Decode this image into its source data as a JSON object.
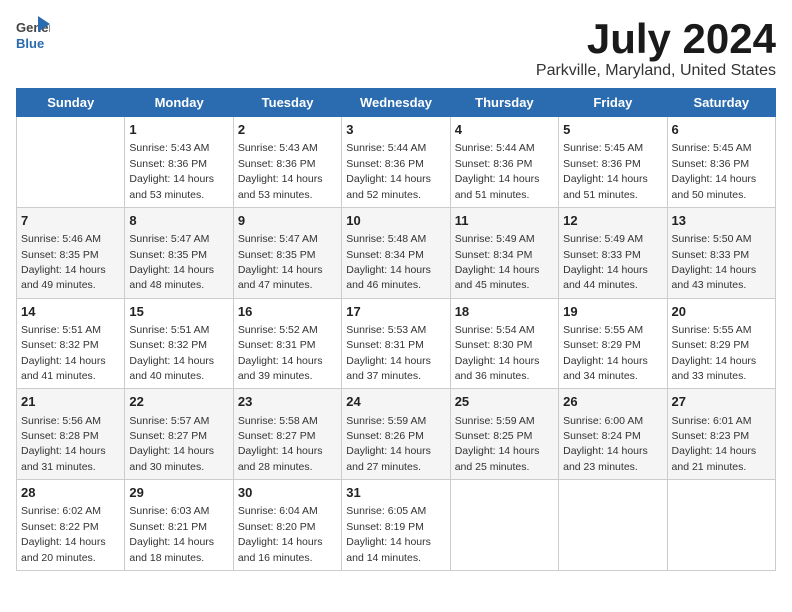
{
  "logo": {
    "text_general": "General",
    "text_blue": "Blue"
  },
  "title": "July 2024",
  "subtitle": "Parkville, Maryland, United States",
  "weekdays": [
    "Sunday",
    "Monday",
    "Tuesday",
    "Wednesday",
    "Thursday",
    "Friday",
    "Saturday"
  ],
  "weeks": [
    [
      {
        "day": "",
        "sunrise": "",
        "sunset": "",
        "daylight": ""
      },
      {
        "day": "1",
        "sunrise": "Sunrise: 5:43 AM",
        "sunset": "Sunset: 8:36 PM",
        "daylight": "Daylight: 14 hours and 53 minutes."
      },
      {
        "day": "2",
        "sunrise": "Sunrise: 5:43 AM",
        "sunset": "Sunset: 8:36 PM",
        "daylight": "Daylight: 14 hours and 53 minutes."
      },
      {
        "day": "3",
        "sunrise": "Sunrise: 5:44 AM",
        "sunset": "Sunset: 8:36 PM",
        "daylight": "Daylight: 14 hours and 52 minutes."
      },
      {
        "day": "4",
        "sunrise": "Sunrise: 5:44 AM",
        "sunset": "Sunset: 8:36 PM",
        "daylight": "Daylight: 14 hours and 51 minutes."
      },
      {
        "day": "5",
        "sunrise": "Sunrise: 5:45 AM",
        "sunset": "Sunset: 8:36 PM",
        "daylight": "Daylight: 14 hours and 51 minutes."
      },
      {
        "day": "6",
        "sunrise": "Sunrise: 5:45 AM",
        "sunset": "Sunset: 8:36 PM",
        "daylight": "Daylight: 14 hours and 50 minutes."
      }
    ],
    [
      {
        "day": "7",
        "sunrise": "Sunrise: 5:46 AM",
        "sunset": "Sunset: 8:35 PM",
        "daylight": "Daylight: 14 hours and 49 minutes."
      },
      {
        "day": "8",
        "sunrise": "Sunrise: 5:47 AM",
        "sunset": "Sunset: 8:35 PM",
        "daylight": "Daylight: 14 hours and 48 minutes."
      },
      {
        "day": "9",
        "sunrise": "Sunrise: 5:47 AM",
        "sunset": "Sunset: 8:35 PM",
        "daylight": "Daylight: 14 hours and 47 minutes."
      },
      {
        "day": "10",
        "sunrise": "Sunrise: 5:48 AM",
        "sunset": "Sunset: 8:34 PM",
        "daylight": "Daylight: 14 hours and 46 minutes."
      },
      {
        "day": "11",
        "sunrise": "Sunrise: 5:49 AM",
        "sunset": "Sunset: 8:34 PM",
        "daylight": "Daylight: 14 hours and 45 minutes."
      },
      {
        "day": "12",
        "sunrise": "Sunrise: 5:49 AM",
        "sunset": "Sunset: 8:33 PM",
        "daylight": "Daylight: 14 hours and 44 minutes."
      },
      {
        "day": "13",
        "sunrise": "Sunrise: 5:50 AM",
        "sunset": "Sunset: 8:33 PM",
        "daylight": "Daylight: 14 hours and 43 minutes."
      }
    ],
    [
      {
        "day": "14",
        "sunrise": "Sunrise: 5:51 AM",
        "sunset": "Sunset: 8:32 PM",
        "daylight": "Daylight: 14 hours and 41 minutes."
      },
      {
        "day": "15",
        "sunrise": "Sunrise: 5:51 AM",
        "sunset": "Sunset: 8:32 PM",
        "daylight": "Daylight: 14 hours and 40 minutes."
      },
      {
        "day": "16",
        "sunrise": "Sunrise: 5:52 AM",
        "sunset": "Sunset: 8:31 PM",
        "daylight": "Daylight: 14 hours and 39 minutes."
      },
      {
        "day": "17",
        "sunrise": "Sunrise: 5:53 AM",
        "sunset": "Sunset: 8:31 PM",
        "daylight": "Daylight: 14 hours and 37 minutes."
      },
      {
        "day": "18",
        "sunrise": "Sunrise: 5:54 AM",
        "sunset": "Sunset: 8:30 PM",
        "daylight": "Daylight: 14 hours and 36 minutes."
      },
      {
        "day": "19",
        "sunrise": "Sunrise: 5:55 AM",
        "sunset": "Sunset: 8:29 PM",
        "daylight": "Daylight: 14 hours and 34 minutes."
      },
      {
        "day": "20",
        "sunrise": "Sunrise: 5:55 AM",
        "sunset": "Sunset: 8:29 PM",
        "daylight": "Daylight: 14 hours and 33 minutes."
      }
    ],
    [
      {
        "day": "21",
        "sunrise": "Sunrise: 5:56 AM",
        "sunset": "Sunset: 8:28 PM",
        "daylight": "Daylight: 14 hours and 31 minutes."
      },
      {
        "day": "22",
        "sunrise": "Sunrise: 5:57 AM",
        "sunset": "Sunset: 8:27 PM",
        "daylight": "Daylight: 14 hours and 30 minutes."
      },
      {
        "day": "23",
        "sunrise": "Sunrise: 5:58 AM",
        "sunset": "Sunset: 8:27 PM",
        "daylight": "Daylight: 14 hours and 28 minutes."
      },
      {
        "day": "24",
        "sunrise": "Sunrise: 5:59 AM",
        "sunset": "Sunset: 8:26 PM",
        "daylight": "Daylight: 14 hours and 27 minutes."
      },
      {
        "day": "25",
        "sunrise": "Sunrise: 5:59 AM",
        "sunset": "Sunset: 8:25 PM",
        "daylight": "Daylight: 14 hours and 25 minutes."
      },
      {
        "day": "26",
        "sunrise": "Sunrise: 6:00 AM",
        "sunset": "Sunset: 8:24 PM",
        "daylight": "Daylight: 14 hours and 23 minutes."
      },
      {
        "day": "27",
        "sunrise": "Sunrise: 6:01 AM",
        "sunset": "Sunset: 8:23 PM",
        "daylight": "Daylight: 14 hours and 21 minutes."
      }
    ],
    [
      {
        "day": "28",
        "sunrise": "Sunrise: 6:02 AM",
        "sunset": "Sunset: 8:22 PM",
        "daylight": "Daylight: 14 hours and 20 minutes."
      },
      {
        "day": "29",
        "sunrise": "Sunrise: 6:03 AM",
        "sunset": "Sunset: 8:21 PM",
        "daylight": "Daylight: 14 hours and 18 minutes."
      },
      {
        "day": "30",
        "sunrise": "Sunrise: 6:04 AM",
        "sunset": "Sunset: 8:20 PM",
        "daylight": "Daylight: 14 hours and 16 minutes."
      },
      {
        "day": "31",
        "sunrise": "Sunrise: 6:05 AM",
        "sunset": "Sunset: 8:19 PM",
        "daylight": "Daylight: 14 hours and 14 minutes."
      },
      {
        "day": "",
        "sunrise": "",
        "sunset": "",
        "daylight": ""
      },
      {
        "day": "",
        "sunrise": "",
        "sunset": "",
        "daylight": ""
      },
      {
        "day": "",
        "sunrise": "",
        "sunset": "",
        "daylight": ""
      }
    ]
  ]
}
